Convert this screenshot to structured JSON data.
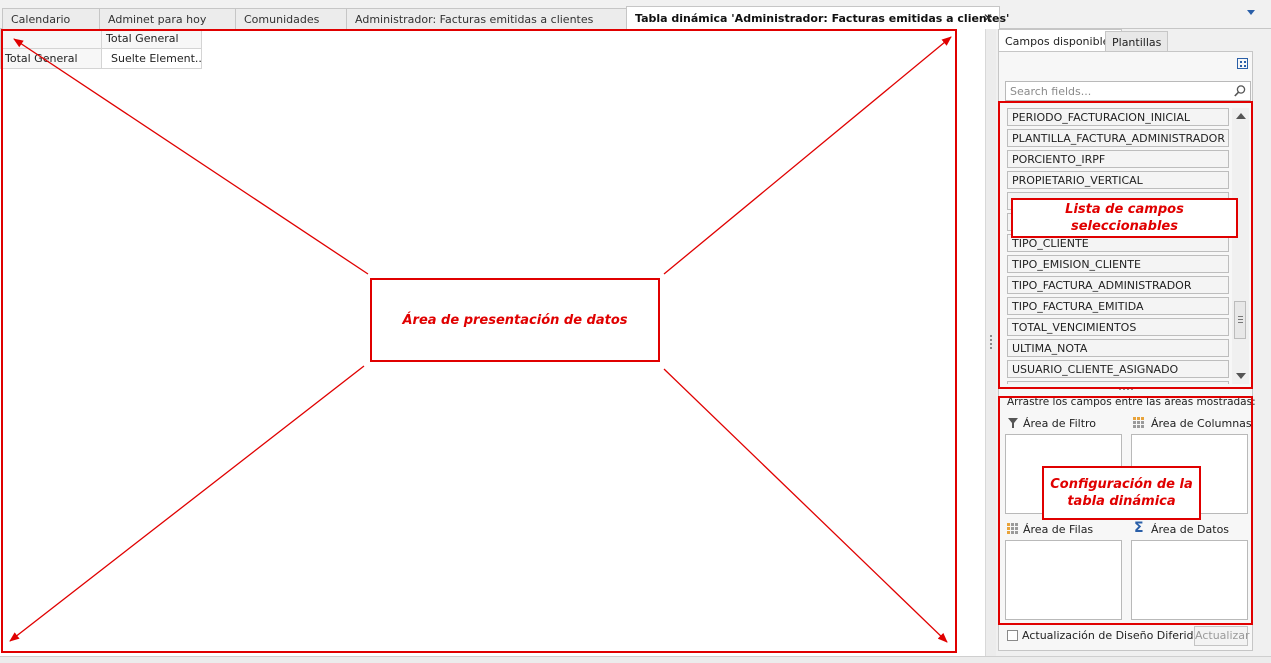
{
  "tabs": [
    {
      "label": "Calendario"
    },
    {
      "label": "Adminet para hoy"
    },
    {
      "label": "Comunidades"
    },
    {
      "label": "Administrador: Facturas emitidas a clientes"
    },
    {
      "label": "Tabla dinámica 'Administrador: Facturas emitidas a clientes'",
      "active": true
    }
  ],
  "pivot": {
    "column_header": "Total General",
    "row_header": "Total General",
    "cell_value": "Suelte Element..."
  },
  "annotations": {
    "data_area": "Área de presentación de datos",
    "field_list": "Lista de campos seleccionables",
    "config": "Configuración de la tabla dinámica"
  },
  "panel": {
    "tabs": [
      "Campos disponibles",
      "Plantillas"
    ],
    "search_placeholder": "Search fields...",
    "fields": [
      "PERIODO_FACTURACION_INICIAL",
      "PLANTILLA_FACTURA_ADMINISTRADOR",
      "PORCIENTO_IRPF",
      "PROPIETARIO_VERTICAL",
      "",
      "",
      "TIPO_CLIENTE",
      "TIPO_EMISION_CLIENTE",
      "TIPO_FACTURA_ADMINISTRADOR",
      "TIPO_FACTURA_EMITIDA",
      "TOTAL_VENCIMIENTOS",
      "ULTIMA_NOTA",
      "USUARIO_CLIENTE_ASIGNADO"
    ],
    "drag_hint": "Arrastre los campos entre las áreas mostradas:",
    "areas": {
      "filter": "Área de Filtro",
      "columns": "Área de Columnas",
      "rows": "Área de Filas",
      "data": "Área de Datos"
    },
    "defer_update_label": "Actualización de Diseño Diferido",
    "update_button": "Actualizar"
  },
  "icons": {
    "close": "close-icon",
    "search": "search-icon",
    "layout": "layout-icon",
    "filter": "filter-icon",
    "columns": "columns-grid-icon",
    "rows": "rows-grid-icon",
    "data": "sigma-icon"
  },
  "colors": {
    "annotation": "#e00000",
    "accent": "#2a5fa8"
  }
}
